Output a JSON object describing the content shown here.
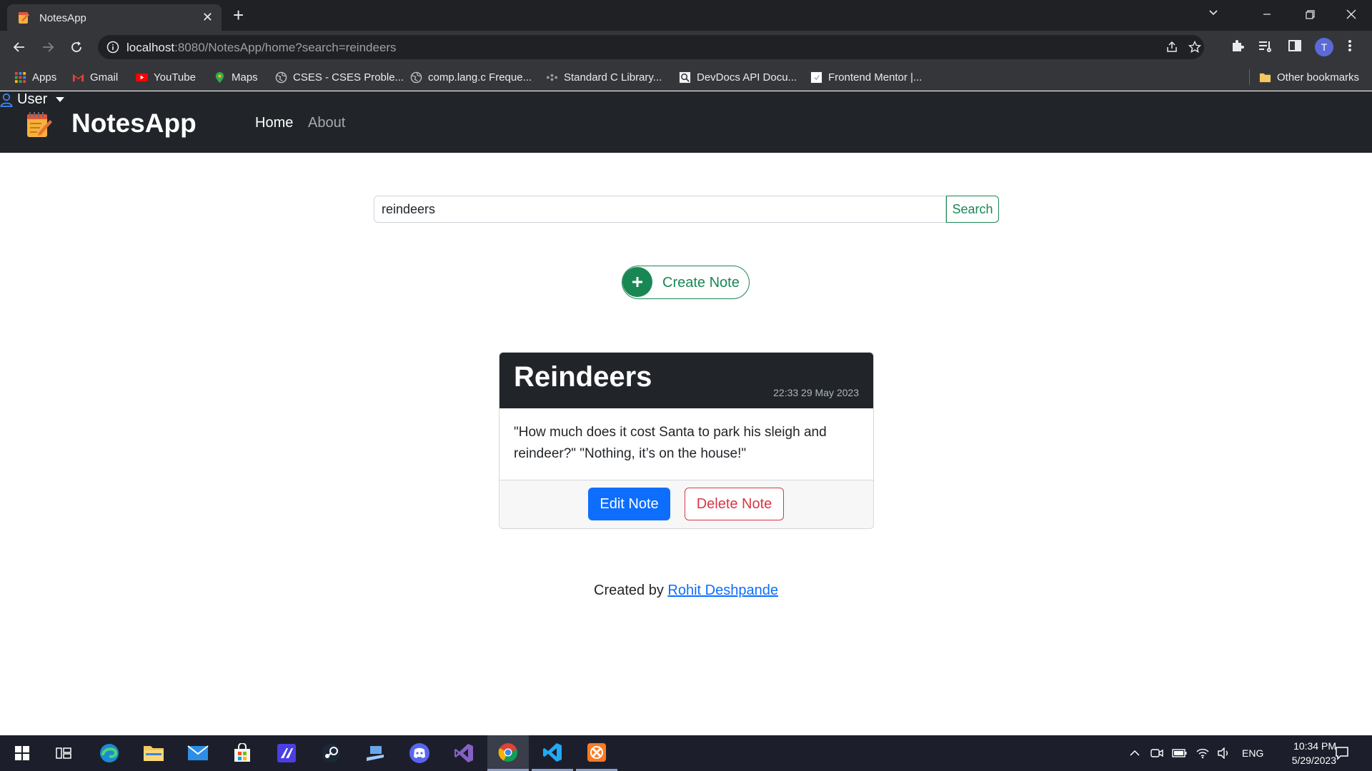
{
  "browser": {
    "tab_title": "NotesApp",
    "tab_close": "✕",
    "new_tab": "+",
    "url_host": "localhost",
    "url_rest": ":8080/NotesApp/home?search=reindeers",
    "avatar_letter": "T"
  },
  "bookmarks": [
    {
      "label": "Apps",
      "icon": "apps-grid-icon"
    },
    {
      "label": "Gmail",
      "icon": "gmail-icon"
    },
    {
      "label": "YouTube",
      "icon": "youtube-icon"
    },
    {
      "label": "Maps",
      "icon": "maps-icon"
    },
    {
      "label": "CSES - CSES Proble...",
      "icon": "globe-icon"
    },
    {
      "label": "comp.lang.c Freque...",
      "icon": "globe-icon"
    },
    {
      "label": "Standard C Library...",
      "icon": "dots-icon"
    },
    {
      "label": "DevDocs API Docu...",
      "icon": "devdocs-icon"
    },
    {
      "label": "Frontend Mentor |...",
      "icon": "page-icon"
    }
  ],
  "other_bookmarks": "Other bookmarks",
  "navbar": {
    "brand": "NotesApp",
    "home": "Home",
    "about": "About",
    "user": "User"
  },
  "search": {
    "value": "reindeers",
    "button": "Search"
  },
  "create": {
    "label": "Create Note"
  },
  "note": {
    "title": "Reindeers",
    "date": "22:33 29 May 2023",
    "body": "\"How much does it cost Santa to park his sleigh and reindeer?\" \"Nothing, it’s on the house!\"",
    "edit": "Edit Note",
    "delete": "Delete Note"
  },
  "footer": {
    "prefix": "Created by ",
    "author": "Rohit Deshpande"
  },
  "taskbar": {
    "language": "ENG",
    "time": "10:34 PM",
    "date": "5/29/2023"
  },
  "colors": {
    "navbar_bg": "#212529",
    "success": "#198754",
    "primary": "#0d6efd",
    "danger": "#dc3545"
  }
}
